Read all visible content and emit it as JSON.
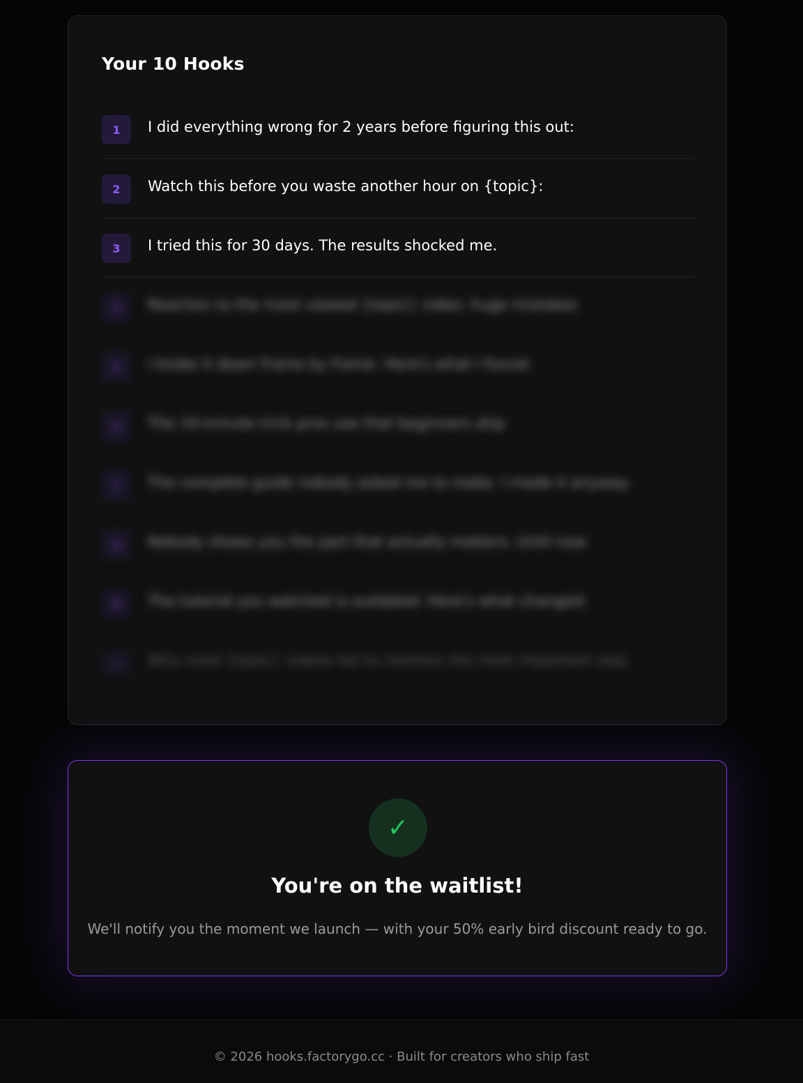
{
  "hooks": {
    "title": "Your 10 Hooks",
    "items": [
      {
        "number": "1",
        "text": "I did everything wrong for 2 years before figuring this out:"
      },
      {
        "number": "2",
        "text": "Watch this before you waste another hour on {topic}:"
      },
      {
        "number": "3",
        "text": "I tried this for 30 days. The results shocked me."
      },
      {
        "number": "4",
        "text": "Reaction to the most viewed {topic} video: huge mistakes"
      },
      {
        "number": "5",
        "text": "I broke it down frame by frame. Here's what I found:"
      },
      {
        "number": "6",
        "text": "The 10-minute trick pros use that beginners skip"
      },
      {
        "number": "7",
        "text": "The complete guide nobody asked me to make. I made it anyway."
      },
      {
        "number": "8",
        "text": "Nobody shows you the part that actually matters. Until now."
      },
      {
        "number": "9",
        "text": "The tutorial you watched is outdated. Here's what changed:"
      },
      {
        "number": "10",
        "text": "Why most {topic} videos fail to mention the most important step"
      }
    ]
  },
  "waitlist": {
    "icon": "check-icon",
    "check_glyph": "✓",
    "title": "You're on the waitlist!",
    "message": "We'll notify you the moment we launch — with your 50% early bird discount ready to go."
  },
  "footer": {
    "text": "© 2026 hooks.factorygo.cc · Built for creators who ship fast"
  },
  "colors": {
    "accent": "#7c3aed",
    "success": "#22c55e",
    "background": "#050505",
    "card": "#111111"
  }
}
